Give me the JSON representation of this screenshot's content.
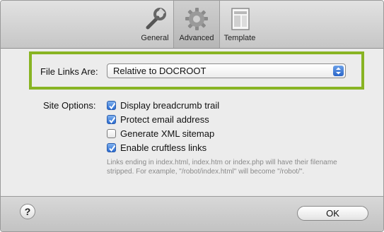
{
  "toolbar": {
    "tabs": [
      {
        "label": "General",
        "icon": "wrench-icon"
      },
      {
        "label": "Advanced",
        "icon": "gear-icon"
      },
      {
        "label": "Template",
        "icon": "document-icon"
      }
    ],
    "selected_tab": "Advanced"
  },
  "file_links": {
    "label": "File Links Are:",
    "selected_value": "Relative to DOCROOT",
    "highlight_color": "#88b423"
  },
  "site_options": {
    "label": "Site Options:",
    "items": [
      {
        "label": "Display breadcrumb trail",
        "checked": true
      },
      {
        "label": "Protect email address",
        "checked": true
      },
      {
        "label": "Generate XML sitemap",
        "checked": false
      },
      {
        "label": "Enable cruftless links",
        "checked": true
      }
    ],
    "help_text": "Links ending in index.html, index.htm or index.php will have their filename stripped. For example, \"/robot/index.html\" will become \"/robot/\"."
  },
  "footer": {
    "help_label": "?",
    "ok_label": "OK"
  },
  "colors": {
    "checkbox_checked": "#2a6bd1",
    "popup_arrows": "#2a65c8"
  }
}
